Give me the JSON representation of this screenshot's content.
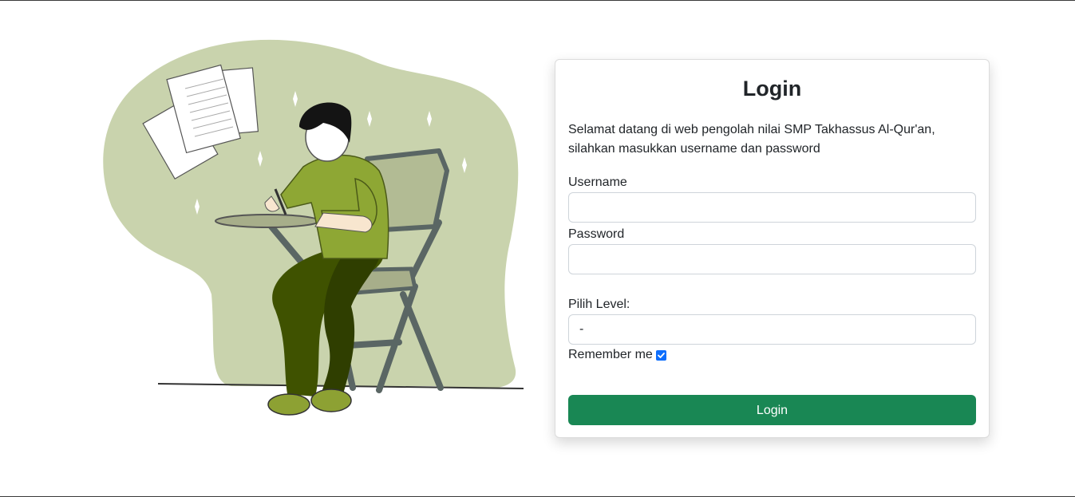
{
  "card": {
    "title": "Login",
    "intro": "Selamat datang di web pengolah nilai SMP Takhassus Al-Qur'an, silahkan masukkan username dan password"
  },
  "form": {
    "username_label": "Username",
    "username_value": "",
    "password_label": "Password",
    "password_value": "",
    "level_label": "Pilih Level:",
    "level_selected": "-",
    "remember_label": "Remember me",
    "remember_checked": true,
    "submit_label": "Login"
  },
  "colors": {
    "primary_button": "#198754",
    "checkbox": "#0d6efd",
    "illustration_blob": "#c9d3ad"
  }
}
